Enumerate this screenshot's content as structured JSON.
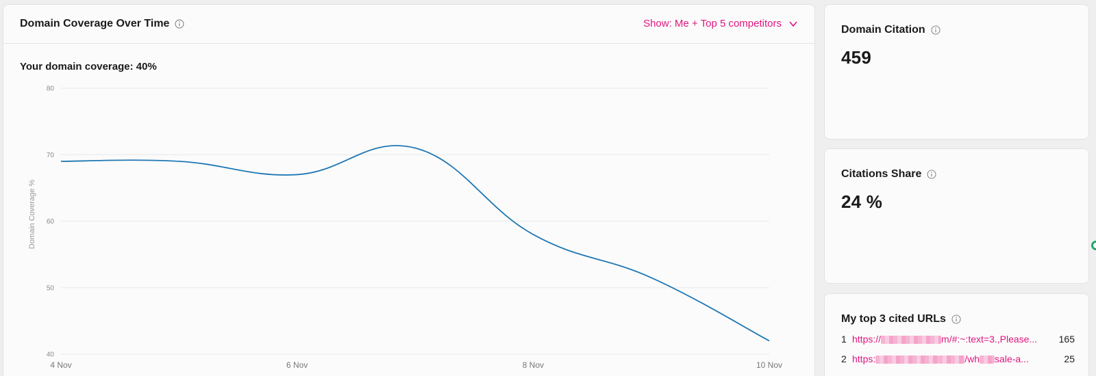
{
  "chart_card": {
    "title": "Domain Coverage Over Time",
    "show_label": "Show: Me + Top 5 competitors",
    "coverage_text": "Your domain coverage: 40%"
  },
  "chart_data": {
    "type": "line",
    "ylabel": "Domain Coverage %",
    "xlabel": "",
    "ylim": [
      40,
      80
    ],
    "yticks": [
      40,
      50,
      60,
      70,
      80
    ],
    "xticks": [
      "4 Nov",
      "6 Nov",
      "8 Nov",
      "10 Nov"
    ],
    "grid": true,
    "series": [
      {
        "color": "#1f77b4",
        "x": [
          "4 Nov",
          "5 Nov",
          "6 Nov",
          "7 Nov",
          "8 Nov",
          "9 Nov",
          "10 Nov"
        ],
        "values": [
          69,
          69,
          67,
          71,
          58,
          51.5,
          42
        ]
      }
    ]
  },
  "citation_card": {
    "title": "Domain Citation",
    "value": "459"
  },
  "share_card": {
    "title": "Citations Share",
    "value": "24 %"
  },
  "urls_card": {
    "title": "My top 3 cited URLs",
    "items": [
      {
        "rank": "1",
        "url_start": "https://",
        "url_end": "m/#:~:text=3.,Please...",
        "count": "165"
      },
      {
        "rank": "2",
        "url_start": "https:",
        "url_mid": "/wh",
        "url_end": "sale-a...",
        "count": "25"
      }
    ]
  },
  "colors": {
    "accent": "#e0157f",
    "line": "#1f77b4"
  }
}
